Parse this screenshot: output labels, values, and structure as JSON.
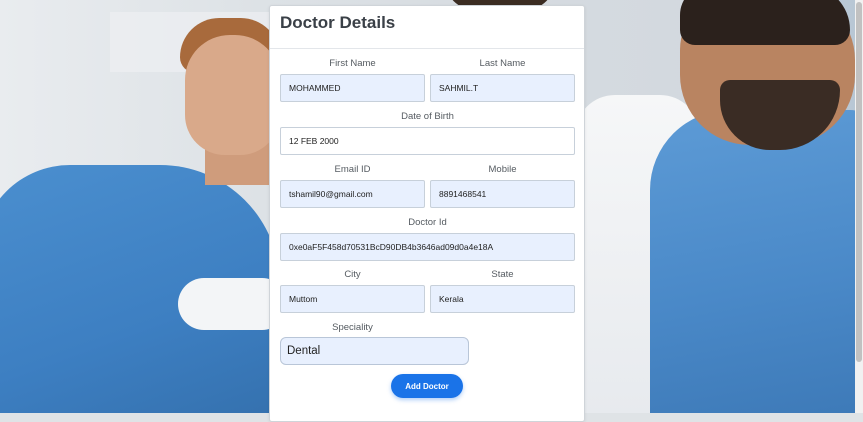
{
  "form": {
    "title": "Doctor Details",
    "first_name_label": "First Name",
    "first_name_value": "MOHAMMED",
    "last_name_label": "Last Name",
    "last_name_value": "SAHMIL.T",
    "dob_label": "Date of Birth",
    "dob_value": "12 FEB 2000",
    "email_label": "Email ID",
    "email_value": "tshamil90@gmail.com",
    "mobile_label": "Mobile",
    "mobile_value": "8891468541",
    "doctor_id_label": "Doctor Id",
    "doctor_id_value": "0xe0aF5F458d70531BcD90DB4b3646ad09d0a4e18A",
    "city_label": "City",
    "city_value": "Muttom",
    "state_label": "State",
    "state_value": "Kerala",
    "speciality_label": "Speciality",
    "speciality_value": "Dental",
    "submit_label": "Add Doctor"
  },
  "colors": {
    "accent": "#1a73e8",
    "autofill": "#e8f0fe"
  }
}
